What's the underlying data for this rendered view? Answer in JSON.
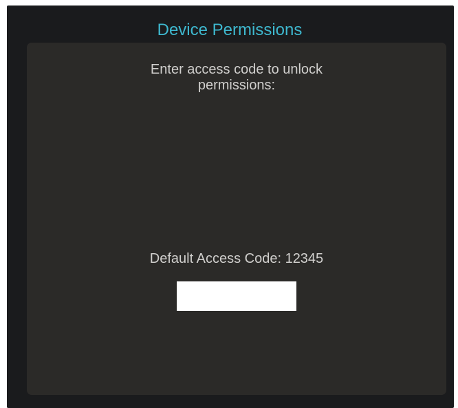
{
  "window": {
    "title": "Device Permissions"
  },
  "panel": {
    "prompt": "Enter access code to unlock permissions:",
    "default_code_label": "Default Access Code: 12345",
    "access_code_input": {
      "value": "",
      "placeholder": ""
    }
  },
  "colors": {
    "window_background": "#1a1b1d",
    "panel_background": "#2b2a28",
    "title_accent": "#3eb8cf",
    "text": "#d0cfcd",
    "input_background": "#ffffff"
  }
}
